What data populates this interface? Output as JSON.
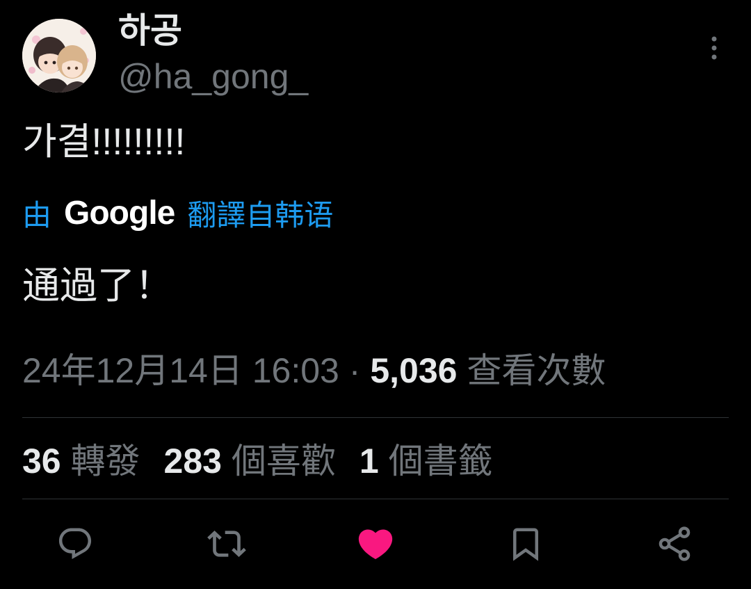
{
  "author": {
    "display_name": "하공",
    "handle": "@ha_gong_"
  },
  "tweet": {
    "text": "가결!!!!!!!!!",
    "translation_notice": {
      "prefix": "由",
      "provider": "Google",
      "suffix": "翻譯自韩语"
    },
    "translated_text": "通過了！"
  },
  "meta": {
    "timestamp": "24年12月14日 16:03",
    "separator": "·",
    "views_count": "5,036",
    "views_label": "查看次數"
  },
  "stats": {
    "retweets_count": "36",
    "retweets_label": "轉發",
    "likes_count": "283",
    "likes_label": "個喜歡",
    "bookmarks_count": "1",
    "bookmarks_label": "個書籤"
  },
  "actions": {
    "reply_icon": "reply-icon",
    "retweet_icon": "retweet-icon",
    "like_icon": "heart-icon",
    "bookmark_icon": "bookmark-icon",
    "share_icon": "share-icon"
  },
  "colors": {
    "background": "#000000",
    "primary_text": "#e7e9ea",
    "secondary_text": "#71767b",
    "link_blue": "#1d9bf0",
    "like_pink": "#f91880",
    "divider": "#2f3336"
  }
}
